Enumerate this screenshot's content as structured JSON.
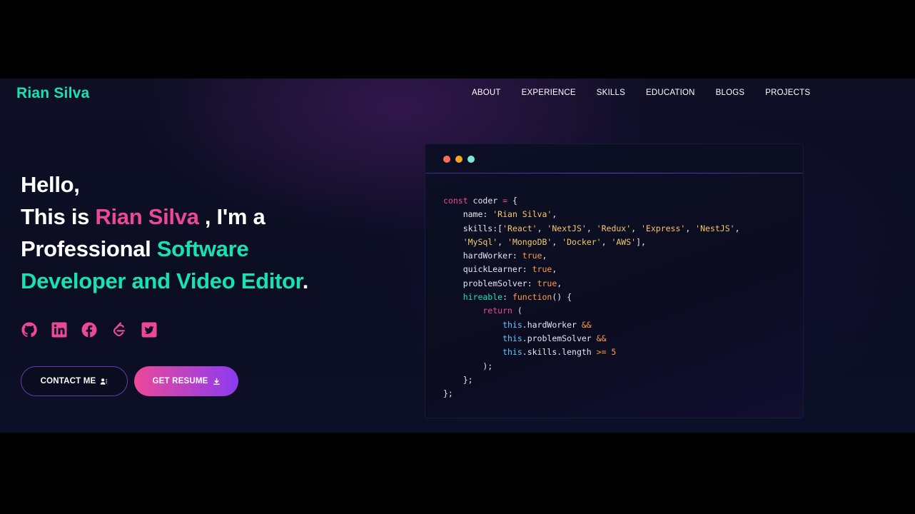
{
  "brand": {
    "name": "Rian Silva",
    "color": "#16e2b4"
  },
  "nav": {
    "items": [
      "ABOUT",
      "EXPERIENCE",
      "SKILLS",
      "EDUCATION",
      "BLOGS",
      "PROJECTS"
    ]
  },
  "hero": {
    "line1": "Hello,",
    "line2_prefix": "This is ",
    "line2_name": "Rian Silva",
    "line2_suffix": " , I'm a",
    "line3_prefix": "Professional ",
    "line3_highlight": "Software",
    "line4_highlight": "Developer and Video Editor",
    "line4_suffix": ".",
    "name_color": "#ec4899",
    "highlight_color": "#16e2b4"
  },
  "socials": [
    "github-icon",
    "linkedin-icon",
    "facebook-icon",
    "leetcode-icon",
    "twitter-icon"
  ],
  "buttons": {
    "contact_label": "CONTACT ME",
    "resume_label": "GET RESUME"
  },
  "code_window": {
    "dot_colors": [
      "#ff6b5a",
      "#f5a623",
      "#7ee8d8"
    ],
    "lines": [
      [
        [
          "kw",
          "const"
        ],
        [
          "pl",
          " coder "
        ],
        [
          "kw",
          "="
        ],
        [
          "pl",
          " {"
        ]
      ],
      [
        [
          "pl",
          "    name: "
        ],
        [
          "str",
          "'Rian Silva'"
        ],
        [
          "pl",
          ","
        ]
      ],
      [
        [
          "pl",
          "    skills:["
        ],
        [
          "str",
          "'React'"
        ],
        [
          "pl",
          ", "
        ],
        [
          "str",
          "'NextJS'"
        ],
        [
          "pl",
          ", "
        ],
        [
          "str",
          "'Redux'"
        ],
        [
          "pl",
          ", "
        ],
        [
          "str",
          "'Express'"
        ],
        [
          "pl",
          ", "
        ],
        [
          "str",
          "'NestJS'"
        ],
        [
          "pl",
          ","
        ]
      ],
      [
        [
          "pl",
          "    "
        ],
        [
          "str",
          "'MySql'"
        ],
        [
          "pl",
          ", "
        ],
        [
          "str",
          "'MongoDB'"
        ],
        [
          "pl",
          ", "
        ],
        [
          "str",
          "'Docker'"
        ],
        [
          "pl",
          ", "
        ],
        [
          "str",
          "'AWS'"
        ],
        [
          "pl",
          "],"
        ]
      ],
      [
        [
          "pl",
          "    hardWorker: "
        ],
        [
          "op",
          "true"
        ],
        [
          "pl",
          ","
        ]
      ],
      [
        [
          "pl",
          "    quickLearner: "
        ],
        [
          "op",
          "true"
        ],
        [
          "pl",
          ","
        ]
      ],
      [
        [
          "pl",
          "    problemSolver: "
        ],
        [
          "op",
          "true"
        ],
        [
          "pl",
          ","
        ]
      ],
      [
        [
          "fn",
          "    hireable"
        ],
        [
          "pl",
          ": "
        ],
        [
          "op",
          "function"
        ],
        [
          "pl",
          "() {"
        ]
      ],
      [
        [
          "kw",
          "        return"
        ],
        [
          "pl",
          " ("
        ]
      ],
      [
        [
          "th",
          "            this"
        ],
        [
          "pl",
          ".hardWorker "
        ],
        [
          "op",
          "&&"
        ]
      ],
      [
        [
          "th",
          "            this"
        ],
        [
          "pl",
          ".problemSolver "
        ],
        [
          "op",
          "&&"
        ]
      ],
      [
        [
          "th",
          "            this"
        ],
        [
          "pl",
          ".skills.length "
        ],
        [
          "op",
          ">="
        ],
        [
          "num",
          " 5"
        ]
      ],
      [
        [
          "pl",
          "        );"
        ]
      ],
      [
        [
          "pl",
          "    };"
        ]
      ],
      [
        [
          "pl",
          "};"
        ]
      ]
    ]
  }
}
